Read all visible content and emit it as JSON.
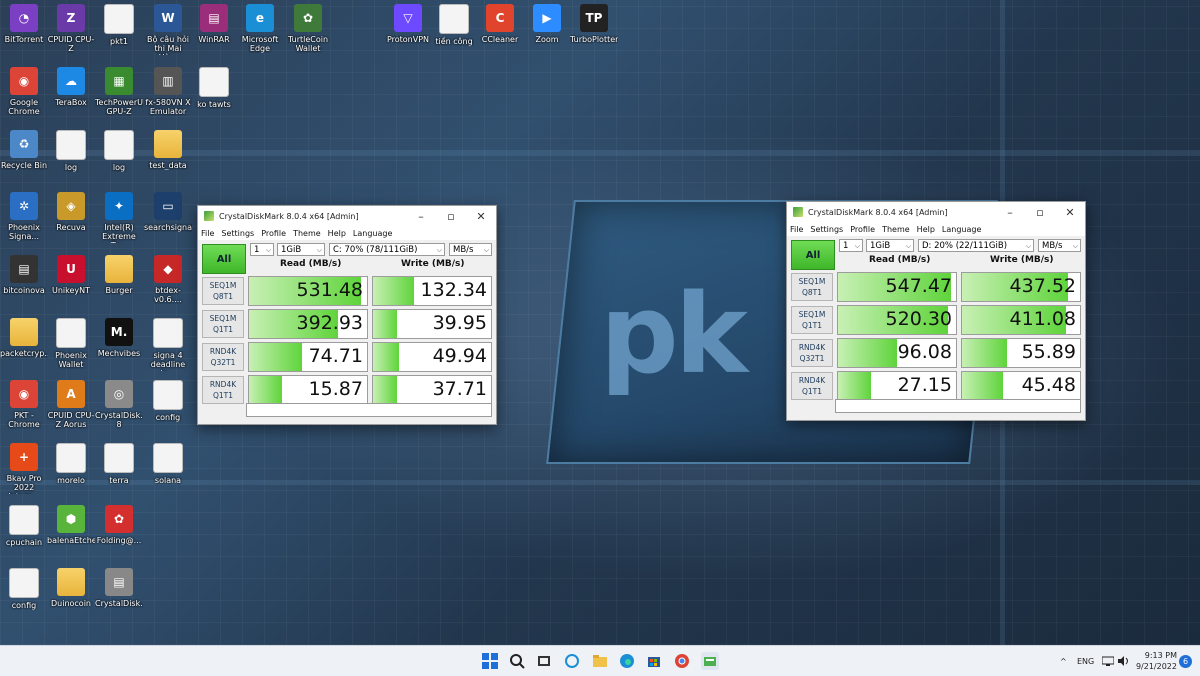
{
  "desktop": {
    "icons": [
      {
        "label": "BitTorrent",
        "glyph": "◔",
        "color": "#7b3fc4"
      },
      {
        "label": "CPUID CPU-Z",
        "glyph": "Z",
        "color": "#6a3aa8"
      },
      {
        "label": "pkt1",
        "glyph": "",
        "color": ""
      },
      {
        "label": "Bộ câu hỏi thi Mai Hù...",
        "glyph": "W",
        "color": "#2b5797"
      },
      {
        "label": "WinRAR",
        "glyph": "▤",
        "color": "#9a2e7a"
      },
      {
        "label": "Microsoft Edge",
        "glyph": "e",
        "color": "#1a8fd6"
      },
      {
        "label": "TurtleCoin Wallet",
        "glyph": "✿",
        "color": "#3f7a3a"
      },
      {
        "label": "ProtonVPN",
        "glyph": "▽",
        "color": "#6d4aff"
      },
      {
        "label": "tiền công",
        "glyph": "",
        "color": ""
      },
      {
        "label": "CCleaner",
        "glyph": "C",
        "color": "#e0442c"
      },
      {
        "label": "Zoom",
        "glyph": "▶",
        "color": "#2d8cff"
      },
      {
        "label": "TurboPlotter",
        "glyph": "TP",
        "color": "#222222"
      },
      {
        "label": "Google Chrome",
        "glyph": "◉",
        "color": "#db4437"
      },
      {
        "label": "TeraBox",
        "glyph": "☁",
        "color": "#1e88e5"
      },
      {
        "label": "TechPowerUp GPU-Z",
        "glyph": "▦",
        "color": "#3a8a2f"
      },
      {
        "label": "fx-580VN X Emulator",
        "glyph": "▥",
        "color": "#555555"
      },
      {
        "label": "ko tawts",
        "glyph": "",
        "color": ""
      },
      {
        "label": "Recycle Bin",
        "glyph": "♻",
        "color": "#4c87c7"
      },
      {
        "label": "log",
        "glyph": "",
        "color": ""
      },
      {
        "label": "log",
        "glyph": "",
        "color": ""
      },
      {
        "label": "test_data",
        "glyph": "",
        "color": ""
      },
      {
        "label": "Phoenix Signa...",
        "glyph": "✲",
        "color": "#2a6fc4"
      },
      {
        "label": "Recuva",
        "glyph": "◈",
        "color": "#c99a2a"
      },
      {
        "label": "Intel(R) Extreme Tu...",
        "glyph": "✦",
        "color": "#0a6fc2"
      },
      {
        "label": "searchsignal",
        "glyph": "▭",
        "color": "#1d3f6b"
      },
      {
        "label": "bitcoinova",
        "glyph": "▤",
        "color": "#333333"
      },
      {
        "label": "UnikeyNT",
        "glyph": "U",
        "color": "#c8102e"
      },
      {
        "label": "Burger",
        "glyph": "",
        "color": ""
      },
      {
        "label": "btdex-v0.6....",
        "glyph": "◆",
        "color": "#c62828"
      },
      {
        "label": "packetcryp...",
        "glyph": "",
        "color": ""
      },
      {
        "label": "Phoenix Wallet",
        "glyph": "",
        "color": ""
      },
      {
        "label": "Mechvibes",
        "glyph": "M.",
        "color": "#111111"
      },
      {
        "label": "signa 4 deadline in...",
        "glyph": "",
        "color": ""
      },
      {
        "label": "PKT - Chrome",
        "glyph": "◉",
        "color": "#db4437"
      },
      {
        "label": "CPUID CPU-Z Aorus",
        "glyph": "A",
        "color": "#e07b1a"
      },
      {
        "label": "CrystalDisk... 8",
        "glyph": "◎",
        "color": "#8a8a8a"
      },
      {
        "label": "config",
        "glyph": "",
        "color": ""
      },
      {
        "label": "Bkav Pro 2022 Intern...",
        "glyph": "+",
        "color": "#e64a19"
      },
      {
        "label": "morelo",
        "glyph": "",
        "color": ""
      },
      {
        "label": "terra",
        "glyph": "",
        "color": ""
      },
      {
        "label": "solana",
        "glyph": "",
        "color": ""
      },
      {
        "label": "cpuchain",
        "glyph": "",
        "color": ""
      },
      {
        "label": "balenaEtcher",
        "glyph": "⬢",
        "color": "#59b43b"
      },
      {
        "label": "Folding@...",
        "glyph": "✿",
        "color": "#d32f2f"
      },
      {
        "label": "config",
        "glyph": "",
        "color": ""
      },
      {
        "label": "Duinocoin",
        "glyph": "",
        "color": ""
      },
      {
        "label": "CrystalDisk...",
        "glyph": "▤",
        "color": "#888888"
      }
    ]
  },
  "cdm_left": {
    "title": "CrystalDiskMark 8.0.4 x64 [Admin]",
    "menu": [
      "File",
      "Settings",
      "Profile",
      "Theme",
      "Help",
      "Language"
    ],
    "all_label": "All",
    "count": "1",
    "size": "1GiB",
    "drive": "C: 70% (78/111GiB)",
    "unit": "MB/s",
    "read_header": "Read (MB/s)",
    "write_header": "Write (MB/s)",
    "rows": [
      {
        "l1": "SEQ1M",
        "l2": "Q8T1",
        "read": "531.48",
        "write": "132.34",
        "read_frac": 0.95,
        "write_frac": 0.35
      },
      {
        "l1": "SEQ1M",
        "l2": "Q1T1",
        "read": "392.93",
        "write": "39.95",
        "read_frac": 0.75,
        "write_frac": 0.2
      },
      {
        "l1": "RND4K",
        "l2": "Q32T1",
        "read": "74.71",
        "write": "49.94",
        "read_frac": 0.45,
        "write_frac": 0.22
      },
      {
        "l1": "RND4K",
        "l2": "Q1T1",
        "read": "15.87",
        "write": "37.71",
        "read_frac": 0.28,
        "write_frac": 0.2
      }
    ]
  },
  "cdm_right": {
    "title": "CrystalDiskMark 8.0.4 x64 [Admin]",
    "menu": [
      "File",
      "Settings",
      "Profile",
      "Theme",
      "Help",
      "Language"
    ],
    "all_label": "All",
    "count": "1",
    "size": "1GiB",
    "drive": "D: 20% (22/111GiB)",
    "unit": "MB/s",
    "read_header": "Read (MB/s)",
    "write_header": "Write (MB/s)",
    "rows": [
      {
        "l1": "SEQ1M",
        "l2": "Q8T1",
        "read": "547.47",
        "write": "437.52",
        "read_frac": 0.96,
        "write_frac": 0.9
      },
      {
        "l1": "SEQ1M",
        "l2": "Q1T1",
        "read": "520.30",
        "write": "411.08",
        "read_frac": 0.93,
        "write_frac": 0.88
      },
      {
        "l1": "RND4K",
        "l2": "Q32T1",
        "read": "96.08",
        "write": "55.89",
        "read_frac": 0.5,
        "write_frac": 0.38
      },
      {
        "l1": "RND4K",
        "l2": "Q1T1",
        "read": "27.15",
        "write": "45.48",
        "read_frac": 0.28,
        "write_frac": 0.35
      }
    ]
  },
  "taskbar": {
    "lang": "ENG",
    "time": "9:13 PM",
    "date": "9/21/2022",
    "notif_count": "6"
  }
}
